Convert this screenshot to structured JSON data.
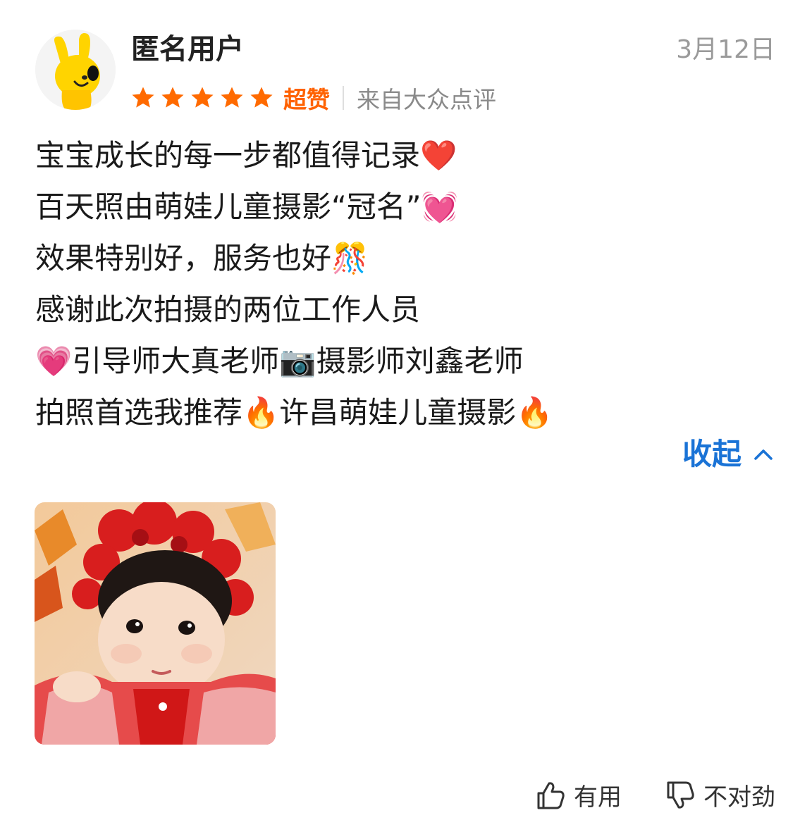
{
  "review": {
    "username": "匿名用户",
    "date": "3月12日",
    "rating_label": "超赞",
    "source": "来自大众点评",
    "lines": [
      "宝宝成长的每一步都值得记录❤️",
      "百天照由萌娃儿童摄影“冠名”💓",
      "效果特别好，服务也好🎊",
      "感谢此次拍摄的两位工作人员",
      "💗引导师大真老师📷摄影师刘鑫老师",
      "拍照首选我推荐🔥许昌萌娃儿童摄影🔥"
    ],
    "collapse_label": "收起",
    "useful_label": "有用",
    "not_right_label": "不对劲"
  },
  "rating": {
    "stars": 5,
    "max": 5
  },
  "colors": {
    "star": "#ff6a00",
    "rating_label": "#ff6200",
    "link": "#1a73d6"
  },
  "icons": [
    "avatar-mascot",
    "star-icon",
    "chevron-up-icon",
    "thumb-up-icon",
    "thumb-down-icon"
  ]
}
